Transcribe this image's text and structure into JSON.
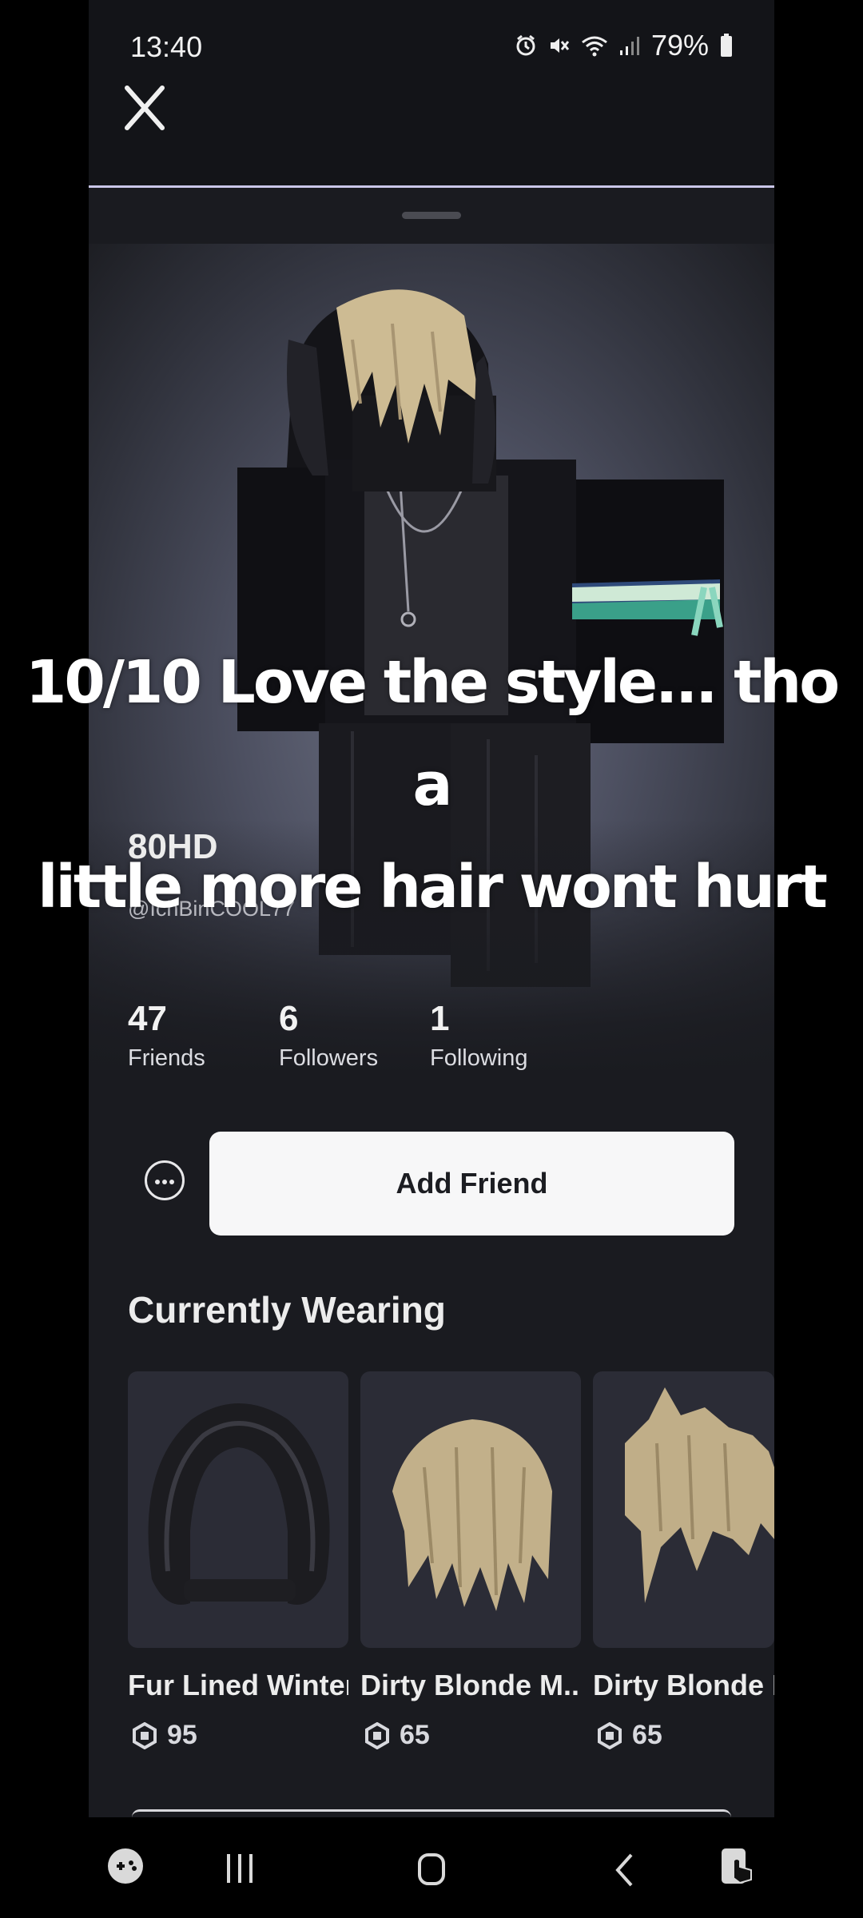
{
  "status": {
    "time": "13:40",
    "battery": "79%"
  },
  "caption": {
    "line1": "10/10 Love the style... tho a",
    "line2": "little more hair wont hurt"
  },
  "profile": {
    "display_name": "80HD",
    "username": "@IchBinCOOL77"
  },
  "stats": [
    {
      "value": "47",
      "label": "Friends"
    },
    {
      "value": "6",
      "label": "Followers"
    },
    {
      "value": "1",
      "label": "Following"
    }
  ],
  "actions": {
    "add_friend_label": "Add Friend"
  },
  "wearing": {
    "title": "Currently Wearing",
    "items": [
      {
        "name": "Fur Lined Winter",
        "price": "95"
      },
      {
        "name": "Dirty Blonde M...",
        "price": "65"
      },
      {
        "name": "Dirty Blonde M",
        "price": "65"
      }
    ]
  },
  "colors": {
    "accent_divider": "#c9c6e8",
    "button_bg": "#f7f7f8"
  }
}
